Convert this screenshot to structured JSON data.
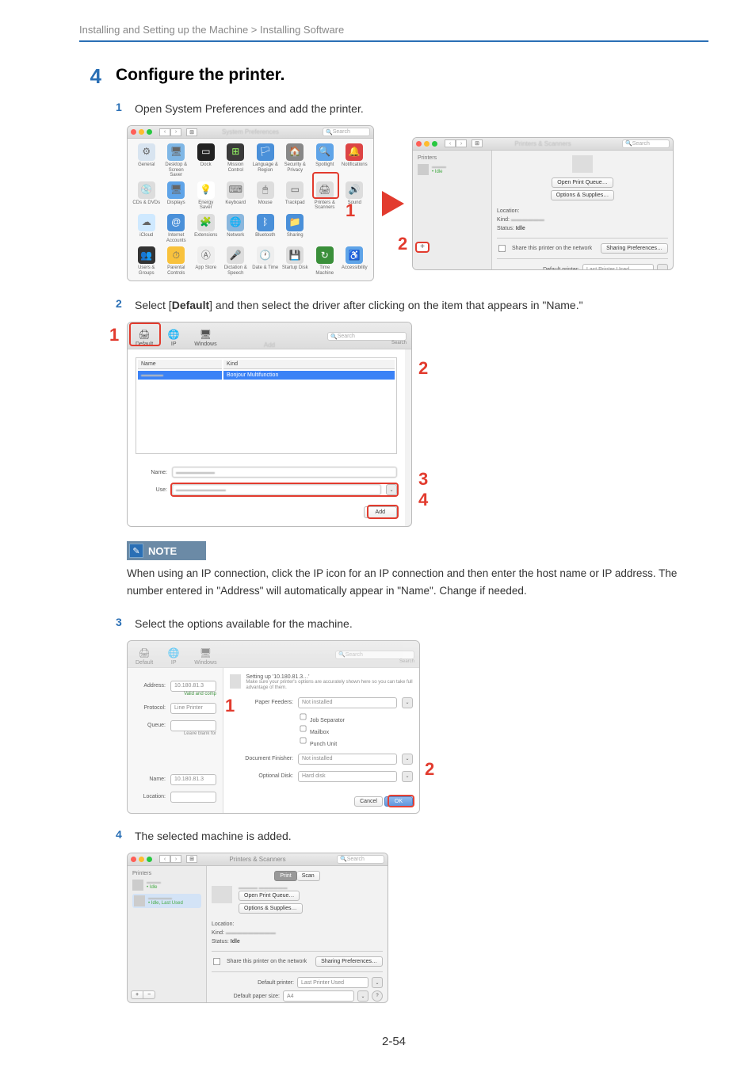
{
  "breadcrumb": "Installing and Setting up the Machine > Installing Software",
  "step": {
    "number": "4",
    "heading": "Configure the printer."
  },
  "substeps": {
    "s1": {
      "num": "1",
      "text": "Open System Preferences and add the printer."
    },
    "s2": {
      "num": "2",
      "pre": "Select [",
      "bold": "Default",
      "post": "] and then select the driver after clicking on the item that appears in \"Name.\""
    },
    "s3": {
      "num": "3",
      "text": "Select the options available for the machine."
    },
    "s4": {
      "num": "4",
      "text": "The selected machine is added."
    }
  },
  "note": {
    "label": "NOTE",
    "body": "When using an IP connection, click the IP icon for an IP connection and then enter the host name or IP address. The number entered in \"Address\" will automatically appear in \"Name\". Change if needed."
  },
  "callouts": {
    "c1": "1",
    "c2": "2",
    "c3": "3",
    "c4": "4"
  },
  "syspref": {
    "search": "Search",
    "items": {
      "general": "General",
      "desktop": "Desktop &\nScreen Saver",
      "dock": "Dock",
      "mission": "Mission\nControl",
      "language": "Language\n& Region",
      "security": "Security\n& Privacy",
      "spotlight": "Spotlight",
      "notifications": "Notifications",
      "cds": "CDs & DVDs",
      "displays": "Displays",
      "energy": "Energy\nSaver",
      "keyboard": "Keyboard",
      "mouse": "Mouse",
      "trackpad": "Trackpad",
      "printers": "Printers &\nScanners",
      "sound": "Sound",
      "icloud": "iCloud",
      "internet": "Internet\nAccounts",
      "extensions": "Extensions",
      "network": "Network",
      "bluetooth": "Bluetooth",
      "sharing": "Sharing",
      "users": "Users &\nGroups",
      "parental": "Parental\nControls",
      "appstore": "App Store",
      "dictation": "Dictation\n& Speech",
      "datetime": "Date & Time",
      "startup": "Startup\nDisk",
      "time": "Time\nMachine",
      "accessibility": "Accessibility"
    }
  },
  "printers": {
    "title": "Printers & Scanners",
    "sidebarLabel": "Printers",
    "status": "Idle",
    "lastUsed": "Idle, Last Used",
    "openQueue": "Open Print Queue…",
    "options": "Options & Supplies…",
    "locationLabel": "Location:",
    "kindLabel": "Kind:",
    "statusLabel": "Status:",
    "statusValue": "Idle",
    "share": "Share this printer on the network",
    "sharingPrefs": "Sharing Preferences…",
    "defaultPrinter": "Default printer:",
    "defaultPrinterValue": "Last Printer Used",
    "paperSize": "Default paper size:",
    "paperSizeValue": "A4",
    "plus": "+",
    "minus": "−",
    "printTab": "Print",
    "scanTab": "Scan",
    "help": "?"
  },
  "addPrinter": {
    "title": "Add",
    "tabDefault": "Default",
    "tabIP": "IP",
    "tabWindows": "Windows",
    "search": "Search",
    "searchLabel": "Search",
    "colName": "Name",
    "colKind": "Kind",
    "kindValue": "Bonjour Multifunction",
    "nameLabel": "Name:",
    "useLabel": "Use:",
    "addButton": "Add"
  },
  "addIP": {
    "addressLabel": "Address:",
    "addressValue": "10.180.81.3",
    "addressHint": "Valid and comp",
    "protocolLabel": "Protocol:",
    "protocolValue": "Line Printer",
    "queueLabel": "Queue:",
    "queueHint": "Leave blank for",
    "nameLabel": "Name:",
    "nameValue": "10.180.81.3",
    "locationLabel": "Location:",
    "popupTitle": "Setting up '10.180.81.3…'",
    "popupHint": "Make sure your printer's options are accurately shown here so you can take full advantage of them.",
    "paperFeeders": "Paper Feeders:",
    "paperFeedersValue": "Not installed",
    "jobSeparator": "Job Separator",
    "mailbox": "Mailbox",
    "punchUnit": "Punch Unit",
    "docFinisher": "Document Finisher:",
    "docFinisherValue": "Not installed",
    "optionalDisk": "Optional Disk:",
    "optionalDiskValue": "Hard disk",
    "cancel": "Cancel",
    "ok": "OK"
  },
  "pageNum": "2-54"
}
